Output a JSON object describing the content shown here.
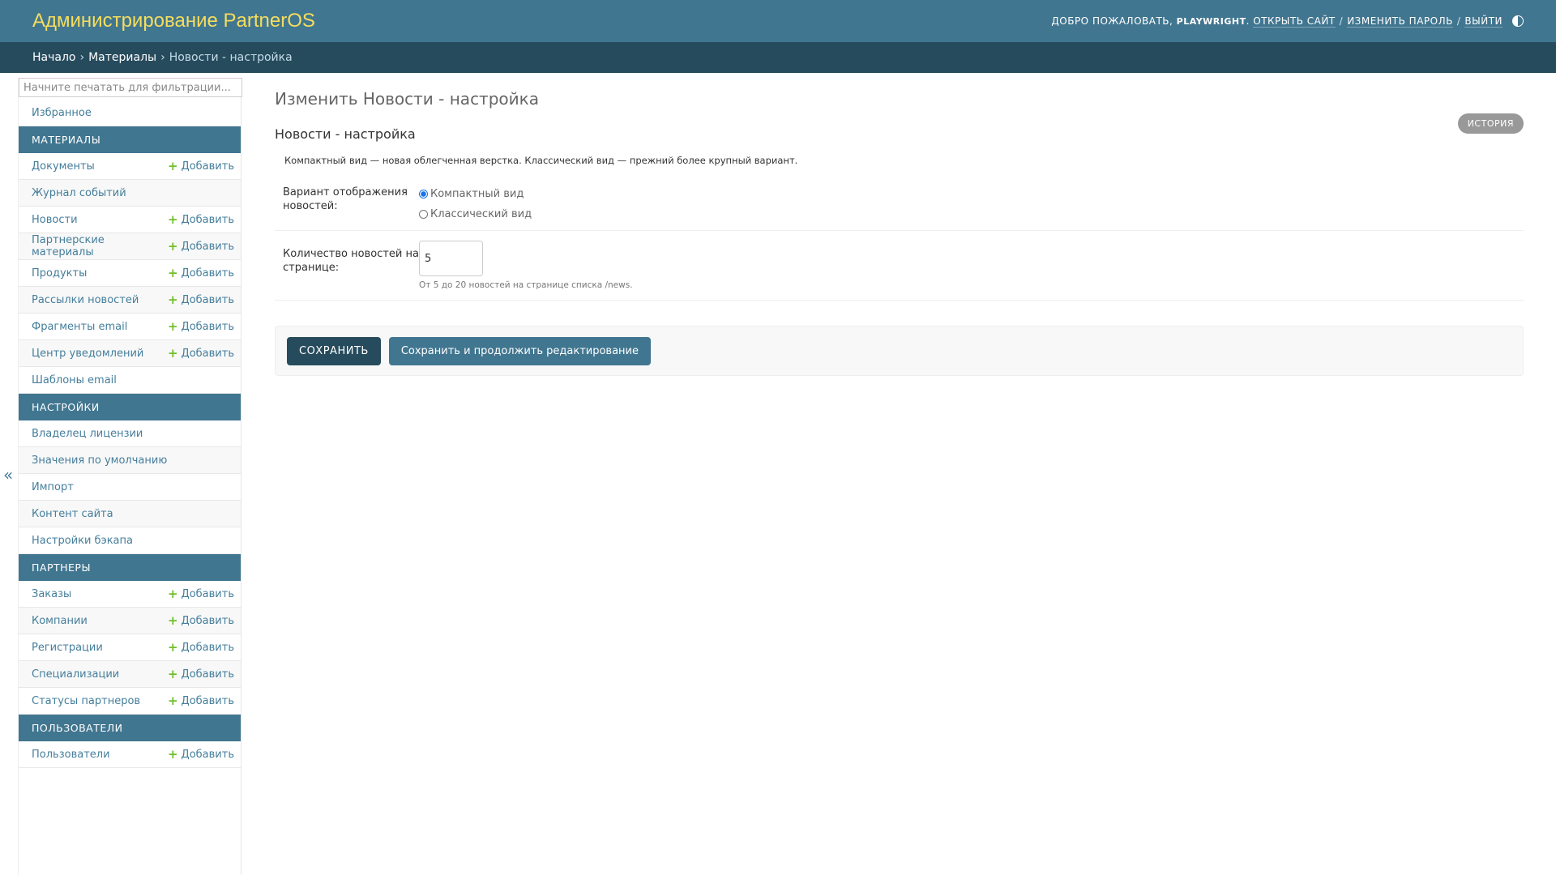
{
  "header": {
    "site_name": "Администрирование PartnerOS",
    "welcome": "ДОБРО ПОЖАЛОВАТЬ,",
    "username": "PLAYWRIGHT",
    "view_site": "ОТКРЫТЬ САЙТ",
    "change_password": "ИЗМЕНИТЬ ПАРОЛЬ",
    "logout": "ВЫЙТИ",
    "separator": "/"
  },
  "breadcrumbs": {
    "home": "Начало",
    "section": "Материалы",
    "current": "Новости - настройка",
    "sep": "›"
  },
  "sidebar": {
    "filter_placeholder": "Начните печатать для фильтрации...",
    "favorites": "Избранное",
    "add_label": "Добавить",
    "groups": [
      {
        "caption": "МАТЕРИАЛЫ",
        "items": [
          {
            "label": "Документы",
            "add": true
          },
          {
            "label": "Журнал событий",
            "add": false
          },
          {
            "label": "Новости",
            "add": true
          },
          {
            "label": "Партнерские материалы",
            "add": true
          },
          {
            "label": "Продукты",
            "add": true
          },
          {
            "label": "Рассылки новостей",
            "add": true
          },
          {
            "label": "Фрагменты email",
            "add": true
          },
          {
            "label": "Центр уведомлений",
            "add": true
          },
          {
            "label": "Шаблоны email",
            "add": false
          }
        ]
      },
      {
        "caption": "НАСТРОЙКИ",
        "items": [
          {
            "label": "Владелец лицензии",
            "add": false
          },
          {
            "label": "Значения по умолчанию",
            "add": false
          },
          {
            "label": "Импорт",
            "add": false
          },
          {
            "label": "Контент сайта",
            "add": false
          },
          {
            "label": "Настройки бэкапа",
            "add": false
          }
        ]
      },
      {
        "caption": "ПАРТНЕРЫ",
        "items": [
          {
            "label": "Заказы",
            "add": true
          },
          {
            "label": "Компании",
            "add": true
          },
          {
            "label": "Регистрации",
            "add": true
          },
          {
            "label": "Специализации",
            "add": true
          },
          {
            "label": "Статусы партнеров",
            "add": true
          }
        ]
      },
      {
        "caption": "ПОЛЬЗОВАТЕЛИ",
        "items": [
          {
            "label": "Пользователи",
            "add": true
          }
        ]
      }
    ],
    "toggle": "«"
  },
  "content": {
    "title": "Изменить Новости - настройка",
    "history": "ИСТОРИЯ",
    "fieldset_title": "Новости - настройка",
    "fieldset_desc": "Компактный вид — новая облегченная верстка. Классический вид — прежний более крупный вариант.",
    "display_label": "Вариант отображения новостей:",
    "options": [
      "Компактный вид",
      "Классический вид"
    ],
    "selected_option": "Компактный вид",
    "per_page_label": "Количество новостей на странице:",
    "per_page_value": "5",
    "per_page_help": "От 5 до 20 новостей на странице списка /news.",
    "save": "СОХРАНИТЬ",
    "save_continue": "Сохранить и продолжить редактирование"
  },
  "colors": {
    "header_bg": "#417690",
    "breadcrumbs_bg": "#264b5d",
    "brand_yellow": "#f5dd5d",
    "link": "#447e9b",
    "add_green": "#70bf2b"
  }
}
